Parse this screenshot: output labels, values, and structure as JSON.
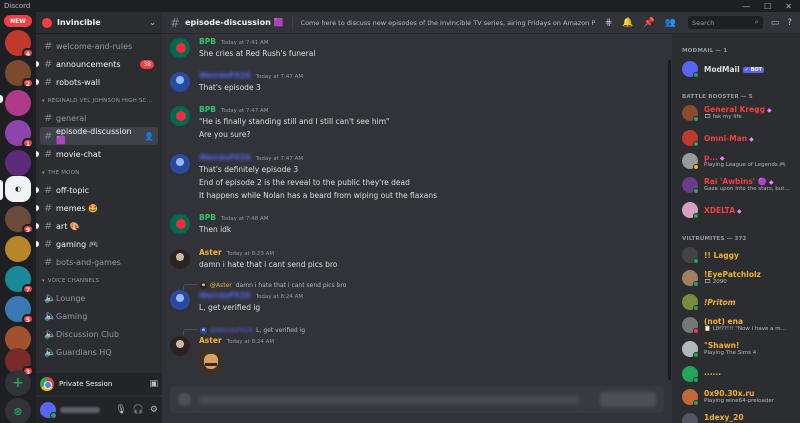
{
  "window": {
    "title": "Discord",
    "controls": [
      "—",
      "☐",
      "✕"
    ]
  },
  "rail": {
    "new_badge": "NEW",
    "badges": [
      "4",
      "2",
      "1",
      "9",
      "7",
      "5",
      "3"
    ]
  },
  "server": {
    "name": "Invincible"
  },
  "sidebar": {
    "top_channels": [
      {
        "label": "welcome-and-rules"
      },
      {
        "label": "announcements",
        "badge": "38"
      },
      {
        "label": "robots-wall"
      }
    ],
    "categories": [
      {
        "label": "REGINALD VEL JOHNSON HIGH SC..."
      },
      {
        "label": "THE MOON"
      },
      {
        "label": "VOICE CHANNELS"
      }
    ],
    "school_channels": [
      {
        "label": "general"
      },
      {
        "label": "episode-discussion 🟪"
      },
      {
        "label": "movie-chat"
      }
    ],
    "moon_channels": [
      {
        "label": "off-topic"
      },
      {
        "label": "memes 🤩"
      },
      {
        "label": "art 🎨"
      },
      {
        "label": "gaming 🎮"
      },
      {
        "label": "bots-and-games"
      }
    ],
    "voice_channels": [
      {
        "label": "Lounge"
      },
      {
        "label": "Gaming"
      },
      {
        "label": "Discussion Club"
      },
      {
        "label": "Guardians HQ"
      }
    ],
    "private_session": "Private Session"
  },
  "header": {
    "channel_name": "episode-discussion 🟪",
    "topic": "Come here to discuss new episodes of the Invincible TV series, airing Fridays on Amazon Prime...",
    "search_placeholder": "Search"
  },
  "messages": [
    {
      "author": "BPB",
      "time": "Today at 7:41 AM",
      "lines": [
        "She cries at Red Rush's funeral"
      ]
    },
    {
      "author": "WeirdoPX26",
      "time": "Today at 7:47 AM",
      "lines": [
        "That's episode 3"
      ]
    },
    {
      "author": "BPB",
      "time": "Today at 7:47 AM",
      "lines": [
        "\"He is finally standing still and I still can't see him\"",
        "Are you sure?"
      ]
    },
    {
      "author": "WeirdoPX26",
      "time": "Today at 7:47 AM",
      "lines": [
        "That's definitely episode 3",
        "End of episode 2 is the reveal to the public they're dead",
        "It happens while Nolan has a beard from wiping out the flaxans"
      ]
    },
    {
      "author": "BPB",
      "time": "Today at 7:48 AM",
      "lines": [
        "Then idk"
      ]
    },
    {
      "author": "Aster",
      "time": "Today at 8:23 AM",
      "lines": [
        "damn i hate that i cant send pics bro"
      ]
    },
    {
      "author": "WeirdoPX26",
      "time": "Today at 8:24 AM",
      "lines": [
        "L, get verified ig"
      ],
      "reply": {
        "author": "@Aster",
        "text": "damn i hate that i cant send pics bro"
      }
    },
    {
      "author": "Aster",
      "time": "Today at 8:24 AM",
      "lines": [],
      "reply": {
        "author": "@WeirdoPX26",
        "text": "L, get verified ig"
      }
    }
  ],
  "members": {
    "categories": [
      "MODMAIL — 1",
      "BATTLE BOOSTER — 5",
      "VILTRUMITES — 372"
    ],
    "list": [
      {
        "name": "ModMail",
        "activity": "",
        "bot": "✓ BOT",
        "color": "#dbdee1",
        "status": "#23a55a"
      },
      {
        "name": "General Kregg",
        "activity": "🎞 fak my life",
        "color": "#f23f43",
        "status": "#23a55a"
      },
      {
        "name": "Omni-Man",
        "activity": "",
        "color": "#f23f43",
        "status": "#23a55a"
      },
      {
        "name": "p...",
        "activity": "Playing League of Legends 🎮",
        "color": "#f23f43",
        "status": "#f0b232"
      },
      {
        "name": "Rai 'Awbins' 🟣",
        "activity": "Gaze upon into the stars, but...",
        "color": "#f23f43",
        "status": "#23a55a"
      },
      {
        "name": "XDELTA",
        "activity": "",
        "color": "#f23f43",
        "status": "#23a55a"
      },
      {
        "name": "!! Laggy",
        "activity": "",
        "color": "#f0b232",
        "status": "#23a55a"
      },
      {
        "name": "!EyePatchlolz",
        "activity": "🎞 2090",
        "color": "#f0b232",
        "status": "#23a55a"
      },
      {
        "name": "!Pritom",
        "activity": "",
        "color": "#f0b232",
        "status": "#23a55a"
      },
      {
        "name": "(not) ena",
        "activity": "📋 L8f??!!! \"Now I have a m...",
        "color": "#f0b232",
        "status": "#f23f43"
      },
      {
        "name": "\"Shawn!",
        "activity": "Playing The Sims 4",
        "color": "#f0b232",
        "status": "#23a55a"
      },
      {
        "name": "......",
        "activity": "",
        "color": "#f0b232",
        "status": "#23a55a"
      },
      {
        "name": "0x90.30x.ru",
        "activity": "Playing wine64-preloader",
        "color": "#f0b232",
        "status": "#23a55a"
      },
      {
        "name": "1dexy_20",
        "activity": "",
        "color": "#f0b232",
        "status": "#23a55a"
      }
    ]
  },
  "colors": {
    "bpb": "#2dc770",
    "weirdo": "#5865f2",
    "aster": "#f0b232"
  }
}
